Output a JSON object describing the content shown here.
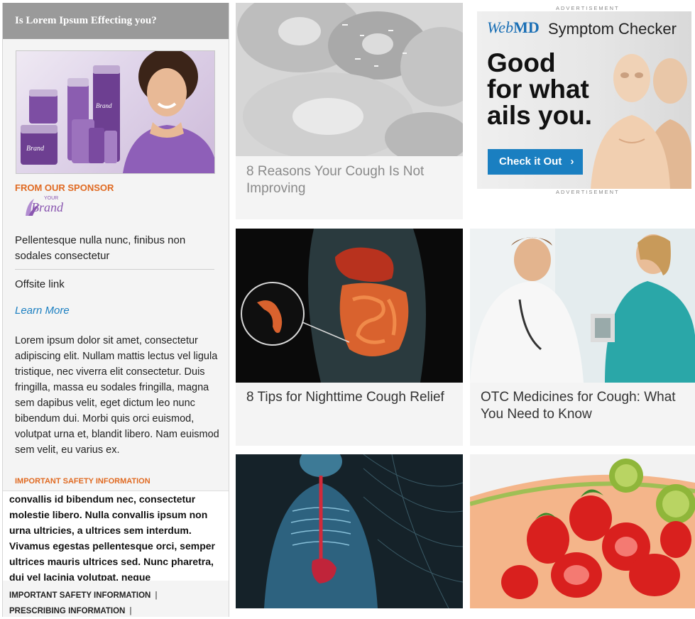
{
  "sponsor": {
    "header": "Is Lorem Ipsum Effecting you?",
    "from_label": "FROM OUR SPONSOR",
    "brand_small": "YOUR",
    "brand_big": "Brand",
    "title": "Pellentesque nulla nunc, finibus non sodales consectetur",
    "offsite_link": "Offsite link",
    "learn_more": "Learn More",
    "body": "Lorem ipsum dolor sit amet, consectetur adipiscing elit. Nullam mattis lectus vel ligula tristique, nec viverra elit consectetur. Duis fringilla, massa eu sodales fringilla, magna sem dapibus velit, eget dictum leo nunc bibendum dui. Morbi quis orci euismod, volutpat urna et, blandit libero. Nam euismod sem velit, eu varius ex.",
    "isi_label": "IMPORTANT SAFETY INFORMATION",
    "isi_text": "convallis id bibendum nec, consectetur molestie libero. Nulla convallis ipsum non urna ultricies, a ultrices sem interdum. Vivamus egestas pellentesque orci, semper ultrices mauris ultrices sed. Nunc pharetra, dui vel lacinia volutpat, neque",
    "isi_link": "IMPORTANT SAFETY INFORMATION",
    "prescribing_link": "PRESCRIBING INFORMATION",
    "separator": "|"
  },
  "articles": [
    {
      "title": "8 Reasons Your Cough Is Not Improving"
    },
    {
      "title": "8 Tips for Nighttime Cough Relief"
    },
    {
      "title": "OTC Medicines for Cough: What You Need to Know"
    }
  ],
  "ad": {
    "label": "ADVERTISEMENT",
    "brand_web": "Web",
    "brand_md": "MD",
    "product": "Symptom Checker",
    "headline_1": "Good",
    "headline_2": "for what",
    "headline_3": "ails you.",
    "cta": "Check it Out",
    "cta_icon": "›"
  },
  "colors": {
    "accent_orange": "#e06a22",
    "link_blue": "#1b7fc1",
    "brand_purple": "#8a57b0"
  }
}
